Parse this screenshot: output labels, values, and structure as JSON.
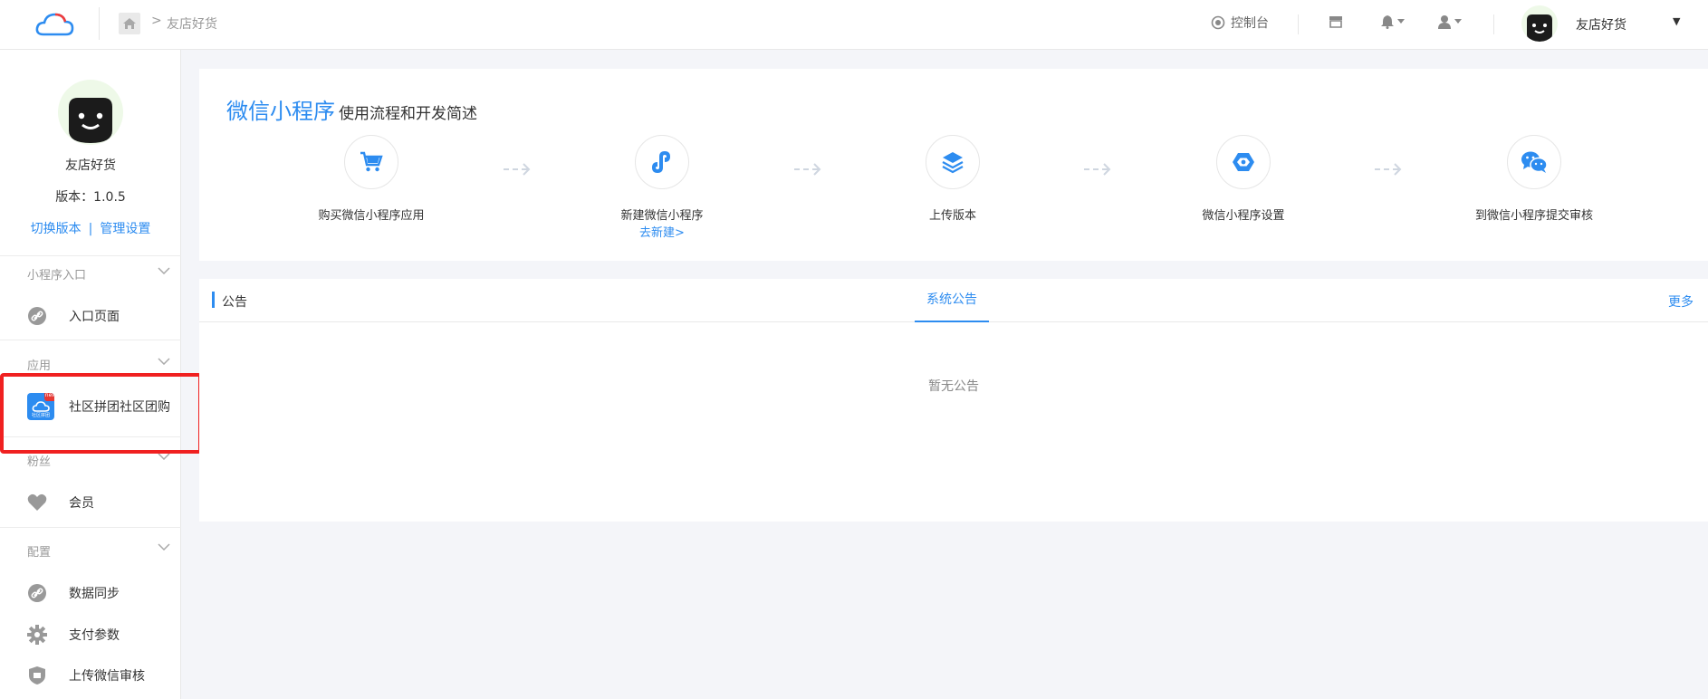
{
  "header": {
    "breadcrumb": "友店好货",
    "console_label": "控制台",
    "user_name": "友店好货"
  },
  "sidebar": {
    "title": "友店好货",
    "version": "版本：1.0.5",
    "switch_version": "切换版本",
    "separator": "|",
    "manage_settings": "管理设置",
    "sections": [
      {
        "label": "小程序入口",
        "items": [
          {
            "label": "入口页面",
            "icon": "link-icon"
          }
        ]
      },
      {
        "label": "应用",
        "items": [
          {
            "label": "社区拼团社区团购",
            "icon": "app-cloud-icon",
            "badge": "new",
            "caption": "社区拼团"
          }
        ]
      },
      {
        "label": "粉丝",
        "items": [
          {
            "label": "会员",
            "icon": "heart-icon"
          }
        ]
      },
      {
        "label": "配置",
        "items": [
          {
            "label": "数据同步",
            "icon": "link-icon"
          },
          {
            "label": "支付参数",
            "icon": "gear-icon"
          },
          {
            "label": "上传微信审核",
            "icon": "shield-icon"
          }
        ]
      }
    ]
  },
  "intro": {
    "title_main": "微信小程序",
    "title_sub": "使用流程和开发简述",
    "steps": [
      {
        "label": "购买微信小程序应用",
        "icon": "cart-icon"
      },
      {
        "label": "新建微信小程序",
        "link": "去新建>",
        "icon": "miniprogram-icon"
      },
      {
        "label": "上传版本",
        "icon": "layers-icon"
      },
      {
        "label": "微信小程序设置",
        "icon": "settings-hex-icon"
      },
      {
        "label": "到微信小程序提交审核",
        "icon": "wechat-icon"
      }
    ]
  },
  "notice": {
    "label": "公告",
    "tab": "系统公告",
    "more": "更多",
    "empty": "暂无公告"
  },
  "colors": {
    "accent": "#2d8cf0",
    "highlight": "#f02020"
  }
}
